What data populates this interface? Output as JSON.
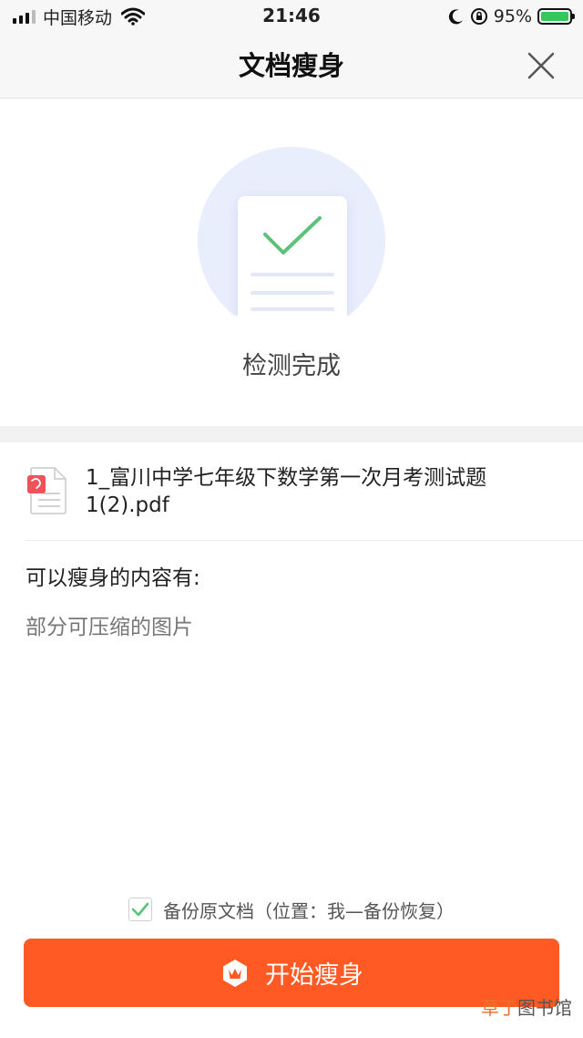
{
  "status_bar": {
    "carrier": "中国移动",
    "time": "21:46",
    "battery": "95%",
    "icons": [
      "signal-icon",
      "wifi-icon",
      "moon-icon",
      "rotation-lock-icon",
      "battery-charging-icon"
    ]
  },
  "nav": {
    "title": "文档瘦身",
    "close_icon": "close-icon"
  },
  "hero": {
    "status": "检测完成",
    "icon": "document-check-icon"
  },
  "file": {
    "name": "1_富川中学七年级下数学第一次月考测试题1(2).pdf",
    "icon": "pdf-file-icon"
  },
  "content": {
    "section_title": "可以瘦身的内容有:",
    "items": [
      "部分可压缩的图片"
    ]
  },
  "backup": {
    "checked": true,
    "label": "备份原文档（位置：我—备份恢复）"
  },
  "start_button": {
    "label": "开始瘦身",
    "icon": "crown-icon"
  },
  "watermark": {
    "accent": "草丁",
    "rest": "图书馆"
  },
  "colors": {
    "accent": "#ff5a23",
    "check": "#5cc27a",
    "hero_bg": "#e9eefc"
  }
}
